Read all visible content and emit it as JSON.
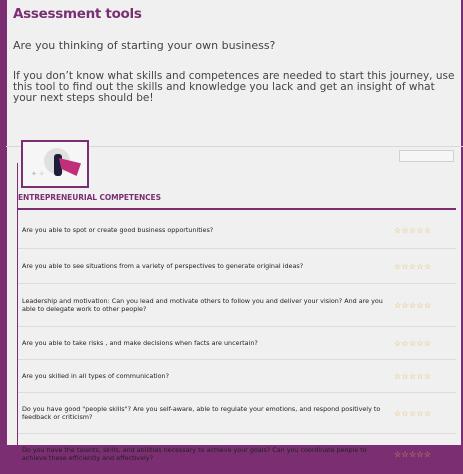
{
  "header": {
    "title": "Assessment tools",
    "question": "Are you thinking of starting your own business?",
    "intro": "If you don’t know what skills and competences are needed to start this journey, use this tool to find out the skills and knowledge you lack and get an insight of what your next steps should be!"
  },
  "section": {
    "label": "ENTREPRENEURIAL COMPETENCES"
  },
  "rating": {
    "stars": "☆☆☆☆☆"
  },
  "rows": [
    {
      "text": "Are you able to spot or create good business opportunities?"
    },
    {
      "text": "Are you able to see situations from a variety of perspectives to generate original ideas?"
    },
    {
      "text": "Leadership and motivation: Can you lead and motivate others to follow you and deliver your vision? And are you able to delegate work to other people?"
    },
    {
      "text": "Are you able to take risks , and make decisions when facts are uncertain?"
    },
    {
      "text": "Are you skilled in all types of communication?"
    },
    {
      "text": "Do you have good \"people skills\"? Are you self-aware, able to regulate your emotions, and respond positively to feedback or criticism?"
    },
    {
      "text": "Do you have the talents, skills, and abilities necessary to achieve your goals? Can you coordinate people to achieve these efficiently and effectively?"
    }
  ],
  "icons": {
    "illustration": "entrepreneur-cape-illustration"
  }
}
